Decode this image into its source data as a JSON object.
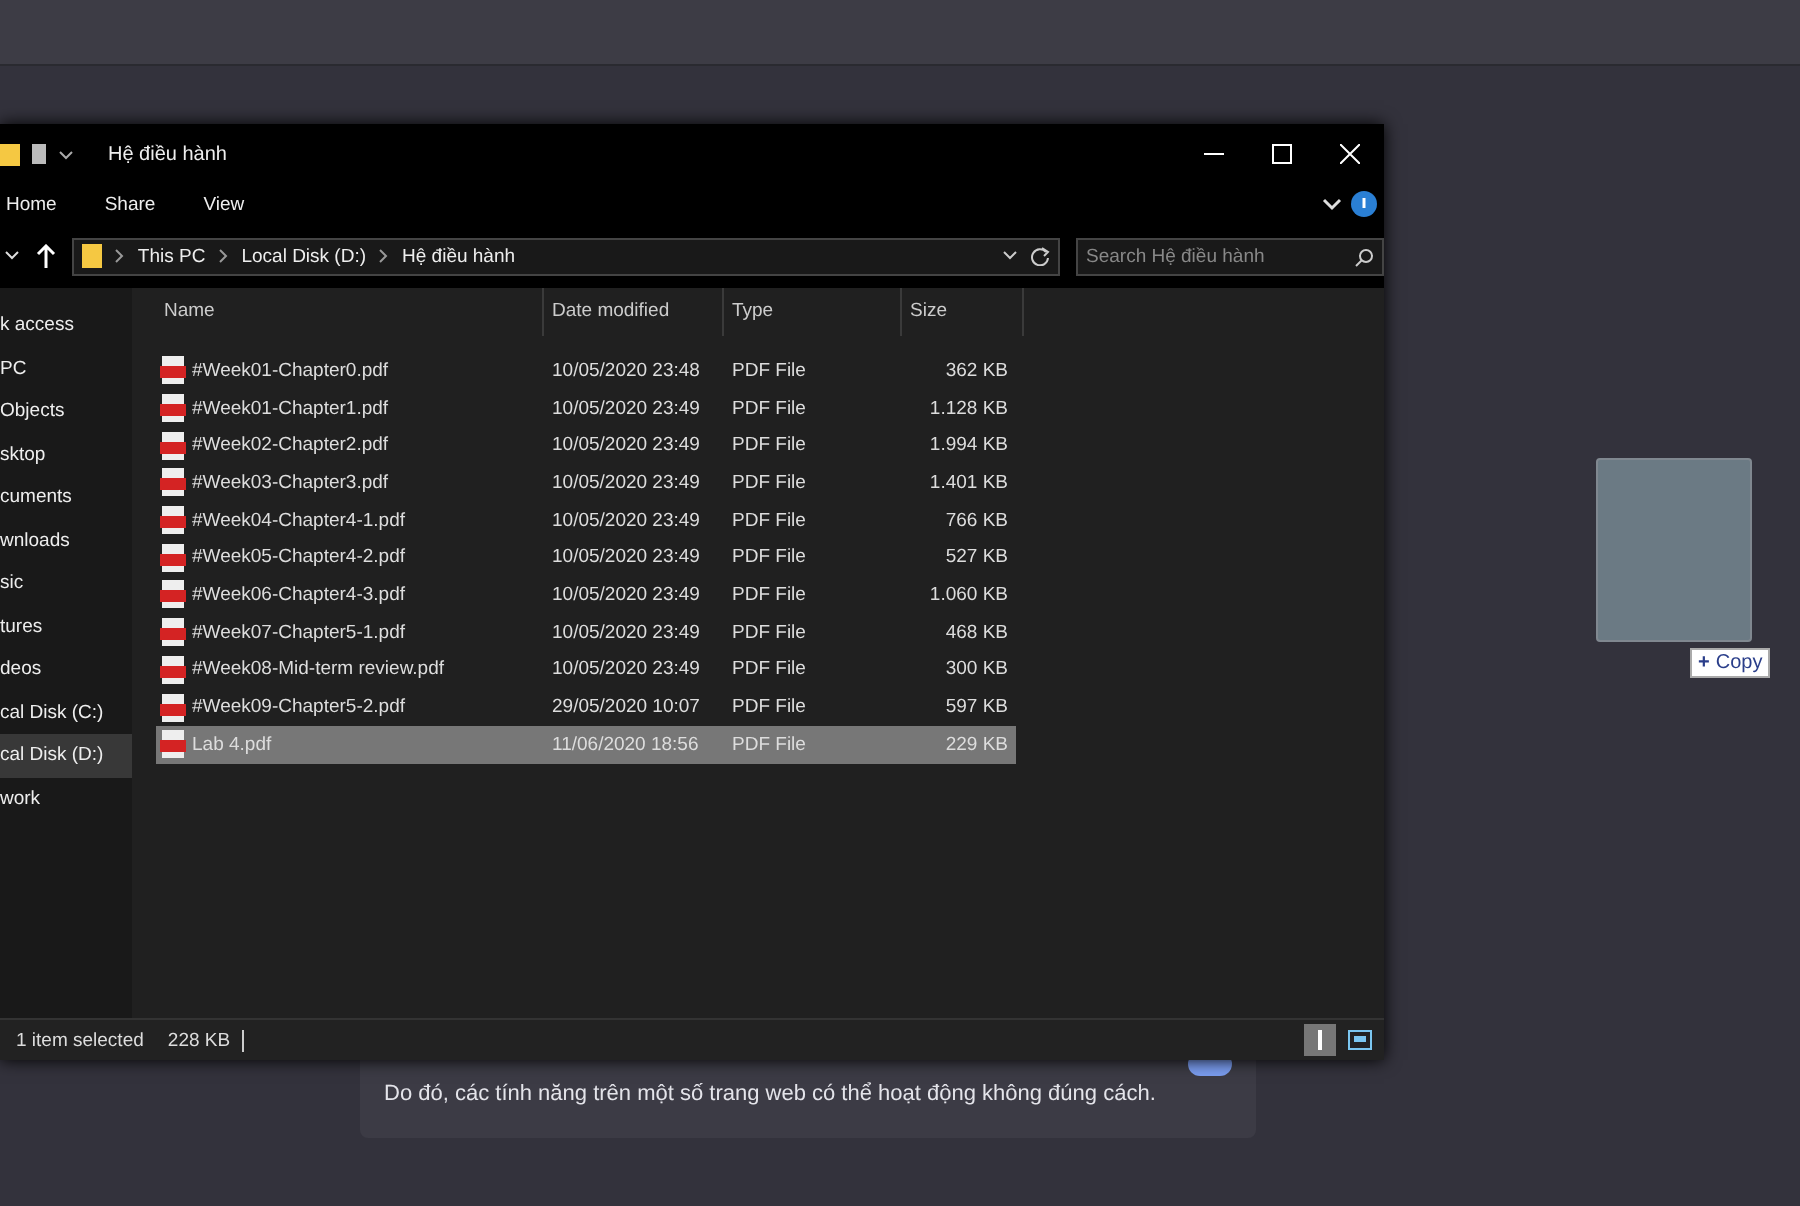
{
  "background_card": {
    "lines": [
      "Do đó, các tính năng trên một số trang web có thể hoạt động không đúng cách."
    ],
    "toggle": {
      "on": true
    }
  },
  "drag": {
    "icon": "+",
    "label": "Copy"
  },
  "window": {
    "title": "Hệ điều hành"
  },
  "ribbon_tabs": [
    "Home",
    "Share",
    "View"
  ],
  "address": {
    "crumbs": [
      "This PC",
      "Local Disk (D:)",
      "Hệ điều hành"
    ]
  },
  "search": {
    "placeholder": "Search Hệ điều hành"
  },
  "sidebar": {
    "items": [
      {
        "label": "k access",
        "selected": false
      },
      {
        "label": "PC",
        "selected": false
      },
      {
        "label": "Objects",
        "selected": false
      },
      {
        "label": "sktop",
        "selected": false
      },
      {
        "label": "cuments",
        "selected": false
      },
      {
        "label": "wnloads",
        "selected": false
      },
      {
        "label": "sic",
        "selected": false
      },
      {
        "label": "tures",
        "selected": false
      },
      {
        "label": "deos",
        "selected": false
      },
      {
        "label": "cal Disk (C:)",
        "selected": false
      },
      {
        "label": "cal Disk (D:)",
        "selected": true
      },
      {
        "label": "work",
        "selected": false
      }
    ]
  },
  "table": {
    "columns": [
      "Name",
      "Date modified",
      "Type",
      "Size"
    ],
    "rows": [
      {
        "name": "#Week01-Chapter0.pdf",
        "date": "10/05/2020 23:48",
        "type": "PDF File",
        "size": "362 KB",
        "selected": false
      },
      {
        "name": "#Week01-Chapter1.pdf",
        "date": "10/05/2020 23:49",
        "type": "PDF File",
        "size": "1.128 KB",
        "selected": false
      },
      {
        "name": "#Week02-Chapter2.pdf",
        "date": "10/05/2020 23:49",
        "type": "PDF File",
        "size": "1.994 KB",
        "selected": false
      },
      {
        "name": "#Week03-Chapter3.pdf",
        "date": "10/05/2020 23:49",
        "type": "PDF File",
        "size": "1.401 KB",
        "selected": false
      },
      {
        "name": "#Week04-Chapter4-1.pdf",
        "date": "10/05/2020 23:49",
        "type": "PDF File",
        "size": "766 KB",
        "selected": false
      },
      {
        "name": "#Week05-Chapter4-2.pdf",
        "date": "10/05/2020 23:49",
        "type": "PDF File",
        "size": "527 KB",
        "selected": false
      },
      {
        "name": "#Week06-Chapter4-3.pdf",
        "date": "10/05/2020 23:49",
        "type": "PDF File",
        "size": "1.060 KB",
        "selected": false
      },
      {
        "name": "#Week07-Chapter5-1.pdf",
        "date": "10/05/2020 23:49",
        "type": "PDF File",
        "size": "468 KB",
        "selected": false
      },
      {
        "name": "#Week08-Mid-term review.pdf",
        "date": "10/05/2020 23:49",
        "type": "PDF File",
        "size": "300 KB",
        "selected": false
      },
      {
        "name": "#Week09-Chapter5-2.pdf",
        "date": "29/05/2020 10:07",
        "type": "PDF File",
        "size": "597 KB",
        "selected": false
      },
      {
        "name": "Lab 4.pdf",
        "date": "11/06/2020 18:56",
        "type": "PDF File",
        "size": "229 KB",
        "selected": true
      }
    ]
  },
  "status_bar": {
    "text": "1 item selected",
    "size": "228 KB"
  }
}
